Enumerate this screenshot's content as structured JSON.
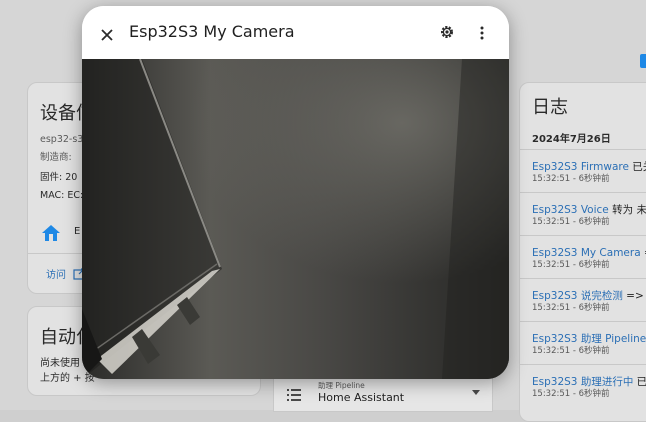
{
  "background": {
    "device_card": {
      "title": "设备信",
      "model": "esp32-s3",
      "manufacturer_label": "制造商:",
      "firmware_label": "固件: 20",
      "mac_label": "MAC: EC:",
      "brand_letter": "E",
      "visit_link": "访问"
    },
    "automation_card": {
      "title": "自动化",
      "line1": "尚未使用",
      "line2": "上方的 + 按"
    },
    "pipeline": {
      "label": "助理 Pipeline",
      "value": "Home Assistant"
    },
    "logbook": {
      "title": "日志",
      "date": "2024年7月26日",
      "entries": [
        {
          "entity": "Esp32S3 Firmware",
          "text": " 已关闭",
          "time": "15:32:51 - 6秒钟前"
        },
        {
          "entity": "Esp32S3 Voice",
          "text": " 转为 未知",
          "time": "15:32:51 - 6秒钟前"
        },
        {
          "entity": "Esp32S3 My Camera",
          "text": " => 空",
          "time": "15:32:51 - 6秒钟前"
        },
        {
          "entity": "Esp32S3 说完检测",
          "text": " => 默认",
          "time": "15:32:51 - 6秒钟前"
        },
        {
          "entity": "Esp32S3 助理 Pipeline",
          "text": " =>",
          "time": "15:32:51 - 6秒钟前"
        },
        {
          "entity": "Esp32S3 助理进行中",
          "text": " 已关",
          "time": "15:32:51 - 6秒钟前"
        }
      ]
    }
  },
  "dialog": {
    "title": "Esp32S3 My Camera",
    "close_icon": "close-icon",
    "settings_icon": "gear-icon",
    "more_icon": "more-vertical-icon"
  },
  "colors": {
    "link": "#2b6fb5",
    "accent": "#1e88e5"
  }
}
